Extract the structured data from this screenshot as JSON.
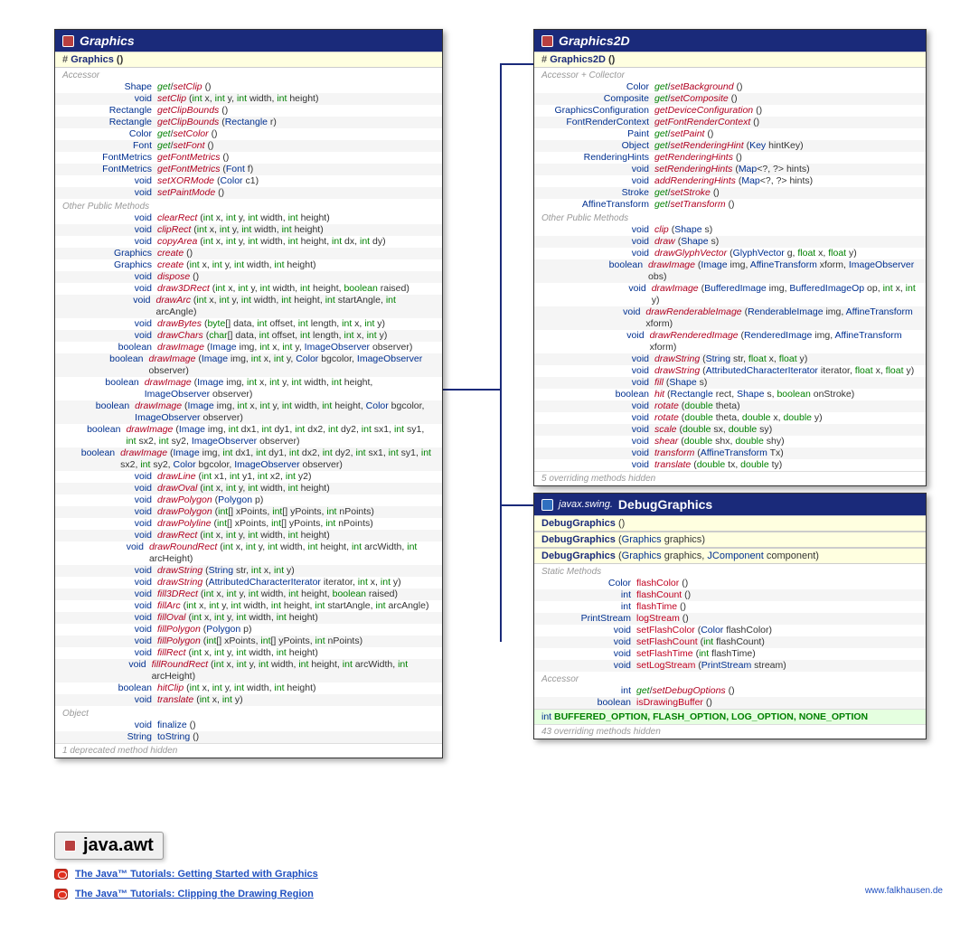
{
  "graphics": {
    "title": "Graphics",
    "constructor": "Graphics",
    "sections": {
      "accessor": "Accessor",
      "other": "Other Public Methods",
      "object": "Object"
    },
    "footer": "1 deprecated method hidden"
  },
  "graphics2d": {
    "title": "Graphics2D",
    "constructor": "Graphics2D",
    "sections": {
      "accessor": "Accessor + Collector",
      "other": "Other Public Methods"
    },
    "footer": "5 overriding methods hidden"
  },
  "debug": {
    "pkg": "javax.swing.",
    "cls": "DebugGraphics",
    "sections": {
      "static": "Static Methods",
      "accessor": "Accessor"
    },
    "constants": "int BUFFERED_OPTION, FLASH_OPTION, LOG_OPTION, NONE_OPTION",
    "footer": "43 overriding methods hidden"
  },
  "package": {
    "name": "java.awt",
    "links": [
      "The Java™ Tutorials: Getting Started with Graphics",
      "The Java™ Tutorials: Clipping the Drawing Region"
    ]
  },
  "credit": "www.falkhausen.de",
  "chart_data": {
    "type": "diagram",
    "description": "UML-style class diagram for java.awt Graphics hierarchy",
    "classes": [
      {
        "name": "Graphics",
        "abstract": true,
        "constructors": [
          {
            "visibility": "protected",
            "signature": "Graphics()"
          }
        ],
        "accessors": [
          {
            "return": "Shape",
            "name": "get/setClip",
            "params": ""
          },
          {
            "return": "void",
            "name": "setClip",
            "params": "int x, int y, int width, int height"
          },
          {
            "return": "Rectangle",
            "name": "getClipBounds",
            "params": ""
          },
          {
            "return": "Rectangle",
            "name": "getClipBounds",
            "params": "Rectangle r"
          },
          {
            "return": "Color",
            "name": "get/setColor",
            "params": ""
          },
          {
            "return": "Font",
            "name": "get/setFont",
            "params": ""
          },
          {
            "return": "FontMetrics",
            "name": "getFontMetrics",
            "params": ""
          },
          {
            "return": "FontMetrics",
            "name": "getFontMetrics",
            "params": "Font f"
          },
          {
            "return": "void",
            "name": "setXORMode",
            "params": "Color c1"
          },
          {
            "return": "void",
            "name": "setPaintMode",
            "params": ""
          }
        ],
        "methods": [
          {
            "return": "void",
            "name": "clearRect",
            "params": "int x, int y, int width, int height"
          },
          {
            "return": "void",
            "name": "clipRect",
            "params": "int x, int y, int width, int height"
          },
          {
            "return": "void",
            "name": "copyArea",
            "params": "int x, int y, int width, int height, int dx, int dy"
          },
          {
            "return": "Graphics",
            "name": "create",
            "params": ""
          },
          {
            "return": "Graphics",
            "name": "create",
            "params": "int x, int y, int width, int height"
          },
          {
            "return": "void",
            "name": "dispose",
            "params": ""
          },
          {
            "return": "void",
            "name": "draw3DRect",
            "params": "int x, int y, int width, int height, boolean raised"
          },
          {
            "return": "void",
            "name": "drawArc",
            "params": "int x, int y, int width, int height, int startAngle, int arcAngle"
          },
          {
            "return": "void",
            "name": "drawBytes",
            "params": "byte[] data, int offset, int length, int x, int y"
          },
          {
            "return": "void",
            "name": "drawChars",
            "params": "char[] data, int offset, int length, int x, int y"
          },
          {
            "return": "boolean",
            "name": "drawImage",
            "params": "Image img, int x, int y, ImageObserver observer"
          },
          {
            "return": "boolean",
            "name": "drawImage",
            "params": "Image img, int x, int y, Color bgcolor, ImageObserver observer"
          },
          {
            "return": "boolean",
            "name": "drawImage",
            "params": "Image img, int x, int y, int width, int height, ImageObserver observer"
          },
          {
            "return": "boolean",
            "name": "drawImage",
            "params": "Image img, int x, int y, int width, int height, Color bgcolor, ImageObserver observer"
          },
          {
            "return": "boolean",
            "name": "drawImage",
            "params": "Image img, int dx1, int dy1, int dx2, int dy2, int sx1, int sy1, int sx2, int sy2, ImageObserver observer"
          },
          {
            "return": "boolean",
            "name": "drawImage",
            "params": "Image img, int dx1, int dy1, int dx2, int dy2, int sx1, int sy1, int sx2, int sy2, Color bgcolor, ImageObserver observer"
          },
          {
            "return": "void",
            "name": "drawLine",
            "params": "int x1, int y1, int x2, int y2"
          },
          {
            "return": "void",
            "name": "drawOval",
            "params": "int x, int y, int width, int height"
          },
          {
            "return": "void",
            "name": "drawPolygon",
            "params": "Polygon p"
          },
          {
            "return": "void",
            "name": "drawPolygon",
            "params": "int[] xPoints, int[] yPoints, int nPoints"
          },
          {
            "return": "void",
            "name": "drawPolyline",
            "params": "int[] xPoints, int[] yPoints, int nPoints"
          },
          {
            "return": "void",
            "name": "drawRect",
            "params": "int x, int y, int width, int height"
          },
          {
            "return": "void",
            "name": "drawRoundRect",
            "params": "int x, int y, int width, int height, int arcWidth, int arcHeight"
          },
          {
            "return": "void",
            "name": "drawString",
            "params": "String str, int x, int y"
          },
          {
            "return": "void",
            "name": "drawString",
            "params": "AttributedCharacterIterator iterator, int x, int y"
          },
          {
            "return": "void",
            "name": "fill3DRect",
            "params": "int x, int y, int width, int height, boolean raised"
          },
          {
            "return": "void",
            "name": "fillArc",
            "params": "int x, int y, int width, int height, int startAngle, int arcAngle"
          },
          {
            "return": "void",
            "name": "fillOval",
            "params": "int x, int y, int width, int height"
          },
          {
            "return": "void",
            "name": "fillPolygon",
            "params": "Polygon p"
          },
          {
            "return": "void",
            "name": "fillPolygon",
            "params": "int[] xPoints, int[] yPoints, int nPoints"
          },
          {
            "return": "void",
            "name": "fillRect",
            "params": "int x, int y, int width, int height"
          },
          {
            "return": "void",
            "name": "fillRoundRect",
            "params": "int x, int y, int width, int height, int arcWidth, int arcHeight"
          },
          {
            "return": "boolean",
            "name": "hitClip",
            "params": "int x, int y, int width, int height"
          },
          {
            "return": "void",
            "name": "translate",
            "params": "int x, int y"
          }
        ],
        "object_methods": [
          {
            "return": "void",
            "name": "finalize",
            "params": ""
          },
          {
            "return": "String",
            "name": "toString",
            "params": ""
          }
        ]
      },
      {
        "name": "Graphics2D",
        "extends": "Graphics",
        "constructors": [
          {
            "visibility": "protected",
            "signature": "Graphics2D()"
          }
        ],
        "accessors": [
          {
            "return": "Color",
            "name": "get/setBackground",
            "params": ""
          },
          {
            "return": "Composite",
            "name": "get/setComposite",
            "params": ""
          },
          {
            "return": "GraphicsConfiguration",
            "name": "getDeviceConfiguration",
            "params": ""
          },
          {
            "return": "FontRenderContext",
            "name": "getFontRenderContext",
            "params": ""
          },
          {
            "return": "Paint",
            "name": "get/setPaint",
            "params": ""
          },
          {
            "return": "Object",
            "name": "get/setRenderingHint",
            "params": "Key hintKey"
          },
          {
            "return": "RenderingHints",
            "name": "getRenderingHints",
            "params": ""
          },
          {
            "return": "void",
            "name": "setRenderingHints",
            "params": "Map<?, ?> hints"
          },
          {
            "return": "void",
            "name": "addRenderingHints",
            "params": "Map<?, ?> hints"
          },
          {
            "return": "Stroke",
            "name": "get/setStroke",
            "params": ""
          },
          {
            "return": "AffineTransform",
            "name": "get/setTransform",
            "params": ""
          }
        ],
        "methods": [
          {
            "return": "void",
            "name": "clip",
            "params": "Shape s"
          },
          {
            "return": "void",
            "name": "draw",
            "params": "Shape s"
          },
          {
            "return": "void",
            "name": "drawGlyphVector",
            "params": "GlyphVector g, float x, float y"
          },
          {
            "return": "boolean",
            "name": "drawImage",
            "params": "Image img, AffineTransform xform, ImageObserver obs"
          },
          {
            "return": "void",
            "name": "drawImage",
            "params": "BufferedImage img, BufferedImageOp op, int x, int y"
          },
          {
            "return": "void",
            "name": "drawRenderableImage",
            "params": "RenderableImage img, AffineTransform xform"
          },
          {
            "return": "void",
            "name": "drawRenderedImage",
            "params": "RenderedImage img, AffineTransform xform"
          },
          {
            "return": "void",
            "name": "drawString",
            "params": "String str, float x, float y"
          },
          {
            "return": "void",
            "name": "drawString",
            "params": "AttributedCharacterIterator iterator, float x, float y"
          },
          {
            "return": "void",
            "name": "fill",
            "params": "Shape s"
          },
          {
            "return": "boolean",
            "name": "hit",
            "params": "Rectangle rect, Shape s, boolean onStroke"
          },
          {
            "return": "void",
            "name": "rotate",
            "params": "double theta"
          },
          {
            "return": "void",
            "name": "rotate",
            "params": "double theta, double x, double y"
          },
          {
            "return": "void",
            "name": "scale",
            "params": "double sx, double sy"
          },
          {
            "return": "void",
            "name": "shear",
            "params": "double shx, double shy"
          },
          {
            "return": "void",
            "name": "transform",
            "params": "AffineTransform Tx"
          },
          {
            "return": "void",
            "name": "translate",
            "params": "double tx, double ty"
          }
        ]
      },
      {
        "name": "DebugGraphics",
        "package": "javax.swing",
        "extends": "Graphics",
        "constructors": [
          {
            "signature": "DebugGraphics()"
          },
          {
            "signature": "DebugGraphics(Graphics graphics)"
          },
          {
            "signature": "DebugGraphics(Graphics graphics, JComponent component)"
          }
        ],
        "static_methods": [
          {
            "return": "Color",
            "name": "flashColor",
            "params": ""
          },
          {
            "return": "int",
            "name": "flashCount",
            "params": ""
          },
          {
            "return": "int",
            "name": "flashTime",
            "params": ""
          },
          {
            "return": "PrintStream",
            "name": "logStream",
            "params": ""
          },
          {
            "return": "void",
            "name": "setFlashColor",
            "params": "Color flashColor"
          },
          {
            "return": "void",
            "name": "setFlashCount",
            "params": "int flashCount"
          },
          {
            "return": "void",
            "name": "setFlashTime",
            "params": "int flashTime"
          },
          {
            "return": "void",
            "name": "setLogStream",
            "params": "PrintStream stream"
          }
        ],
        "accessors": [
          {
            "return": "int",
            "name": "get/setDebugOptions",
            "params": ""
          },
          {
            "return": "boolean",
            "name": "isDrawingBuffer",
            "params": ""
          }
        ],
        "constants": [
          "BUFFERED_OPTION",
          "FLASH_OPTION",
          "LOG_OPTION",
          "NONE_OPTION"
        ]
      }
    ],
    "relationships": [
      {
        "from": "Graphics2D",
        "to": "Graphics",
        "type": "extends"
      },
      {
        "from": "DebugGraphics",
        "to": "Graphics",
        "type": "extends"
      }
    ]
  }
}
